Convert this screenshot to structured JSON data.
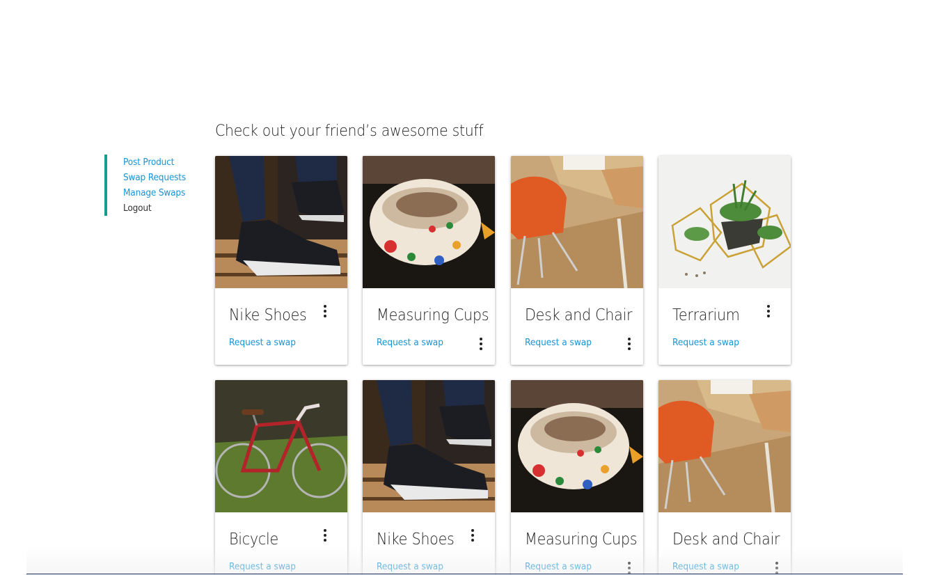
{
  "sidebar": {
    "items": [
      {
        "label": "Post Product"
      },
      {
        "label": "Swap Requests"
      },
      {
        "label": "Manage Swaps"
      },
      {
        "label": "Logout"
      }
    ]
  },
  "main": {
    "title": "Check out your friend’s awesome stuff",
    "cards": [
      {
        "title": "Nike Shoes",
        "action": "Request a swap",
        "image": "nike-shoes-photo"
      },
      {
        "title": "Measuring Cups",
        "action": "Request a swap",
        "image": "measuring-cups-photo"
      },
      {
        "title": "Desk and Chair",
        "action": "Request a swap",
        "image": "desk-chair-photo"
      },
      {
        "title": "Terrarium",
        "action": "Request a swap",
        "image": "terrarium-photo"
      },
      {
        "title": "Bicycle",
        "action": "Request a swap",
        "image": "bicycle-photo"
      },
      {
        "title": "Nike Shoes",
        "action": "Request a swap",
        "image": "nike-shoes-photo"
      },
      {
        "title": "Measuring Cups",
        "action": "Request a swap",
        "image": "measuring-cups-photo"
      },
      {
        "title": "Desk and Chair",
        "action": "Request a swap",
        "image": "desk-chair-photo"
      }
    ]
  },
  "colors": {
    "accent": "#1694d6",
    "sidebar_bar": "#1a9c8c"
  },
  "icons": {
    "card_menu": "more-vert-icon"
  }
}
